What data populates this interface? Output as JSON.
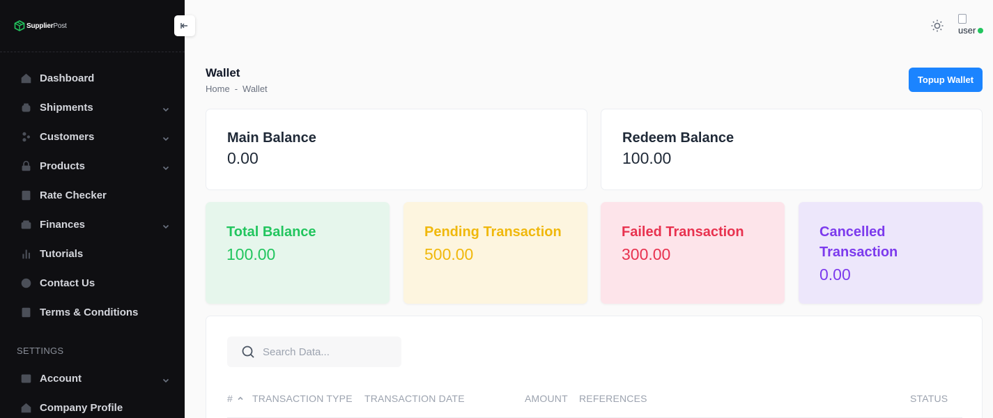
{
  "brand": {
    "name_bold": "Supplier",
    "name_light": "Post"
  },
  "sidebar": {
    "items": [
      {
        "label": "Dashboard",
        "icon": "home-icon",
        "has_submenu": false
      },
      {
        "label": "Shipments",
        "icon": "box-icon",
        "has_submenu": true
      },
      {
        "label": "Customers",
        "icon": "users-icon",
        "has_submenu": true
      },
      {
        "label": "Products",
        "icon": "lock-icon",
        "has_submenu": true
      },
      {
        "label": "Rate Checker",
        "icon": "calculator-icon",
        "has_submenu": false
      },
      {
        "label": "Finances",
        "icon": "wallet-icon",
        "has_submenu": true
      },
      {
        "label": "Tutorials",
        "icon": "bar-chart-icon",
        "has_submenu": false
      },
      {
        "label": "Contact Us",
        "icon": "phone-icon",
        "has_submenu": false
      },
      {
        "label": "Terms & Conditions",
        "icon": "document-icon",
        "has_submenu": false
      }
    ],
    "settings_heading": "SETTINGS",
    "settings_items": [
      {
        "label": "Account",
        "icon": "sliders-icon",
        "has_submenu": true
      },
      {
        "label": "Company Profile",
        "icon": "building-icon",
        "has_submenu": false
      }
    ]
  },
  "header": {
    "avatar_alt": "user",
    "online_color": "#22c55e"
  },
  "page": {
    "title": "Wallet",
    "breadcrumb": [
      "Home",
      "Wallet"
    ],
    "breadcrumb_sep": "-",
    "topup_label": "Topup Wallet"
  },
  "balances": {
    "main": {
      "label": "Main Balance",
      "value": "0.00"
    },
    "redeem": {
      "label": "Redeem Balance",
      "value": "100.00"
    }
  },
  "stats": {
    "total": {
      "label": "Total Balance",
      "value": "100.00",
      "color": "#22c55e"
    },
    "pending": {
      "label": "Pending Transaction",
      "value": "500.00",
      "color": "#f0b80c"
    },
    "failed": {
      "label": "Failed Transaction",
      "value": "300.00",
      "color": "#e8324f"
    },
    "cancelled": {
      "label": "Cancelled Transaction",
      "value": "0.00",
      "color": "#7c3aed"
    }
  },
  "table": {
    "search_placeholder": "Search Data...",
    "columns": [
      "#",
      "TRANSACTION TYPE",
      "TRANSACTION DATE",
      "AMOUNT",
      "REFERENCES",
      "STATUS"
    ]
  },
  "colors": {
    "accent": "#1b84ff",
    "sidebar_bg": "#0f0f12"
  }
}
